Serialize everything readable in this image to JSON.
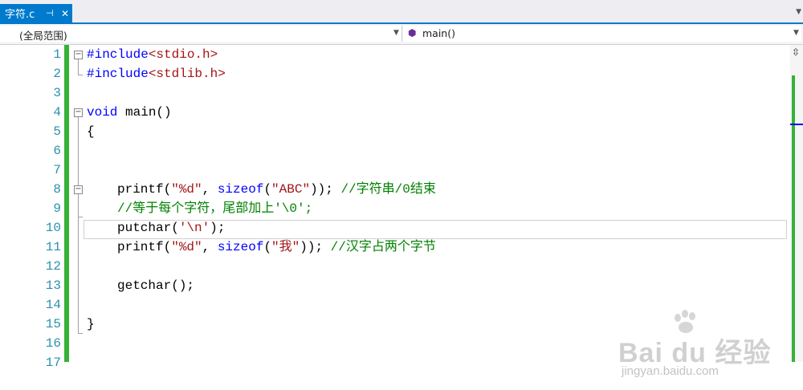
{
  "tab": {
    "title": "字符.c",
    "pin_icon": "pin-icon",
    "close_icon": "close-icon"
  },
  "navbar": {
    "scope": "(全局范围)",
    "member": "main()",
    "member_icon": "method-cube-icon"
  },
  "colors": {
    "accent": "#007acc",
    "line_numbers": "#2b91af",
    "keyword": "#0000ff",
    "string": "#a31515",
    "comment": "#008000",
    "change_bar": "#36b236"
  },
  "line_numbers": [
    "1",
    "2",
    "3",
    "4",
    "5",
    "6",
    "7",
    "8",
    "9",
    "10",
    "11",
    "12",
    "13",
    "14",
    "15",
    "16",
    "17"
  ],
  "code": {
    "l1": {
      "pp": "#include",
      "inc": "<stdio.h>"
    },
    "l2": {
      "pp": "#include",
      "inc": "<stdlib.h>"
    },
    "l4": {
      "kw": "void",
      "rest": " main()"
    },
    "l5": "{",
    "l8": {
      "a": "printf(",
      "s1": "\"%d\"",
      "b": ", ",
      "kw": "sizeof",
      "c": "(",
      "s2": "\"ABC\"",
      "d": ")); ",
      "cm": "//字符串/0结束"
    },
    "l9": {
      "cm": "//等于每个字符，尾部加上'\\0';"
    },
    "l10": {
      "a": "putchar(",
      "s": "'\\n'",
      "b": ");"
    },
    "l11": {
      "a": "printf(",
      "s1": "\"%d\"",
      "b": ", ",
      "kw": "sizeof",
      "c": "(",
      "s2": "\"我\"",
      "d": ")); ",
      "cm": "//汉字占两个字节"
    },
    "l13": "getchar();",
    "l15": "}"
  },
  "watermark": {
    "logo": "Bai du 经验",
    "url": "jingyan.baidu.com"
  }
}
